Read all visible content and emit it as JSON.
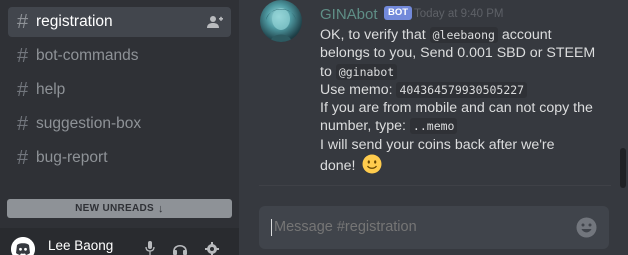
{
  "sidebar": {
    "channels": [
      {
        "name": "registration",
        "active": true
      },
      {
        "name": "bot-commands",
        "active": false
      },
      {
        "name": "help",
        "active": false
      },
      {
        "name": "suggestion-box",
        "active": false
      },
      {
        "name": "bug-report",
        "active": false
      }
    ],
    "hash": "#",
    "new_unreads": {
      "label": "NEW UNREADS",
      "arrow": "↓"
    },
    "user": {
      "name": "Lee Baong"
    }
  },
  "message": {
    "author": "GINAbot",
    "tag": "BOT",
    "timestamp": "Today at 9:40 PM",
    "lines": {
      "l1": "OK, to verify that",
      "l1_code": "@leebaong",
      "l1_end": "account",
      "l2": "belongs to you, Send 0.001 SBD or STEEM",
      "l3": "to",
      "l3_code": "@ginabot",
      "l4": "Use memo:",
      "l4_code": "404364579930505227",
      "l5": "If you are from mobile and can not copy the",
      "l6": "number, type:",
      "l6_code": "..memo",
      "l7": "I will send your coins back after we're",
      "l8": "done!"
    }
  },
  "composer": {
    "placeholder": "Message #registration"
  },
  "colors": {
    "sidebar_bg": "#2f3136",
    "chat_bg": "#36393f",
    "bot_tag": "#7289da",
    "author": "#5f8e86"
  },
  "icons": {
    "add_member": "add-member-icon",
    "mic": "microphone-icon",
    "headphones": "headphones-icon",
    "settings": "gear-icon",
    "emoji": "slightly-smiling-face-icon",
    "composer_emoji": "emoji-picker-icon"
  }
}
